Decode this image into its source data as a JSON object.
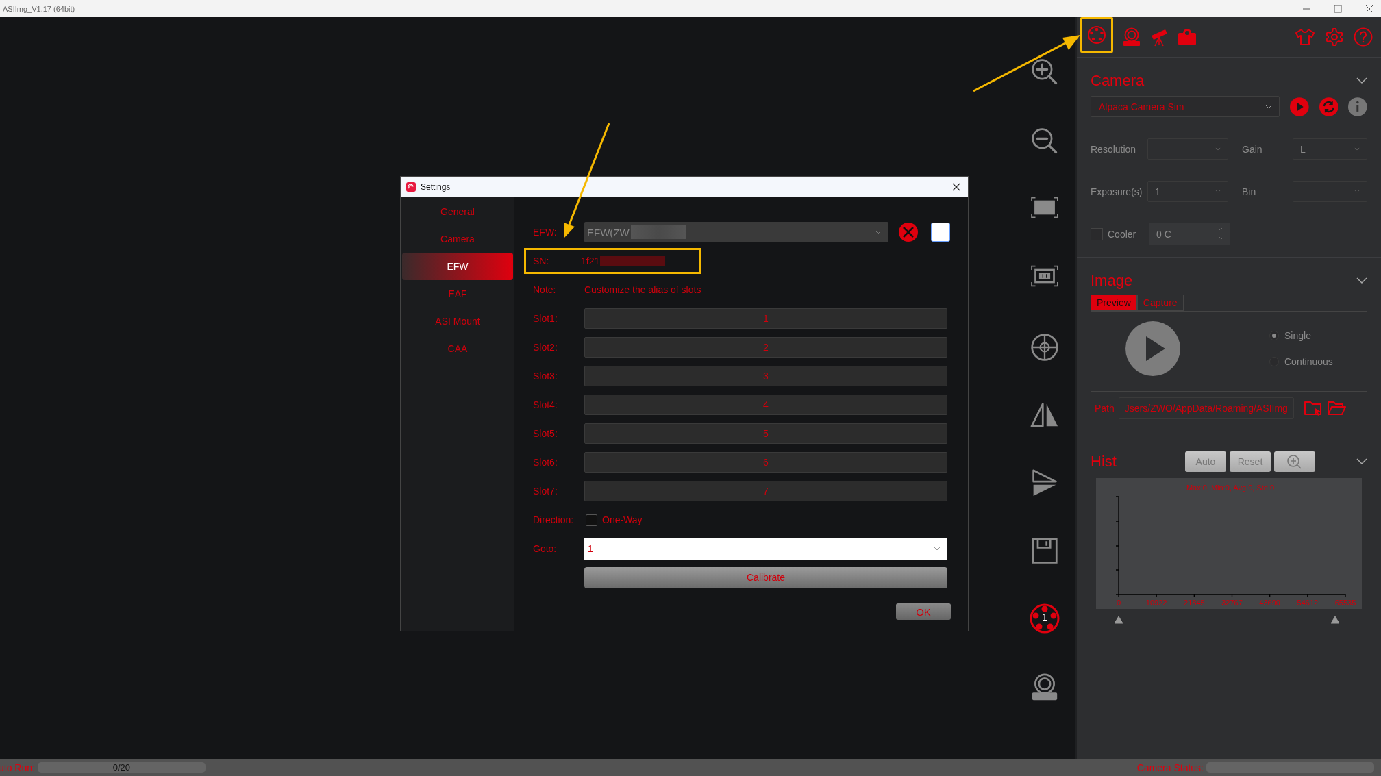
{
  "window": {
    "title": "ASIImg_V1.17 (64bit)"
  },
  "side_toolbar": {
    "filter_wheel_badge": "1"
  },
  "camera": {
    "title": "Camera",
    "device": "Alpaca Camera Sim",
    "fields": [
      {
        "label": "Resolution"
      },
      {
        "label": "Gain",
        "value": "L"
      },
      {
        "label": "Exposure(s)",
        "value": "1"
      },
      {
        "label": "Bin"
      }
    ],
    "cooler": {
      "label": "Cooler",
      "checked": false,
      "value": "0 C"
    }
  },
  "image": {
    "title": "Image",
    "tabs": [
      {
        "label": "Preview",
        "selected": true
      },
      {
        "label": "Capture",
        "selected": false
      }
    ],
    "modes": [
      {
        "label": "Single",
        "selected": true
      },
      {
        "label": "Continuous",
        "selected": false
      }
    ],
    "path_label": "Path",
    "path": "Jsers/ZWO/AppData/Roaming/ASIImg"
  },
  "hist": {
    "title": "Hist",
    "buttons": [
      "Auto",
      "Reset"
    ],
    "stats": "Max:0, Min:0, Avg:0, Std:0",
    "axis_labels": [
      "0",
      "10922",
      "21845",
      "32767",
      "43690",
      "54612",
      "65535"
    ]
  },
  "dialog": {
    "title": "Settings",
    "nav": [
      {
        "label": "General",
        "selected": false
      },
      {
        "label": "Camera",
        "selected": false
      },
      {
        "label": "EFW",
        "selected": true
      },
      {
        "label": "EAF",
        "selected": false
      },
      {
        "label": "ASI Mount",
        "selected": false
      },
      {
        "label": "CAA",
        "selected": false
      }
    ],
    "efw_label": "EFW:",
    "efw": "EFW(ZW",
    "sn_label": "SN:",
    "sn": "1f21",
    "note_label": "Note:",
    "note": "Customize the alias of slots",
    "slots": [
      {
        "label": "Slot1:",
        "value": "1"
      },
      {
        "label": "Slot2:",
        "value": "2"
      },
      {
        "label": "Slot3:",
        "value": "3"
      },
      {
        "label": "Slot4:",
        "value": "4"
      },
      {
        "label": "Slot5:",
        "value": "5"
      },
      {
        "label": "Slot6:",
        "value": "6"
      },
      {
        "label": "Slot7:",
        "value": "7"
      }
    ],
    "direction_label": "Direction:",
    "one_way": {
      "label": "One-Way",
      "checked": false
    },
    "goto_label": "Goto:",
    "goto": "1",
    "calibrate": "Calibrate",
    "ok": "OK"
  },
  "status_bar": {
    "auto_run_label": "uto Run:",
    "progress": "0/20",
    "level": 0,
    "camera_status_label": "Camera Status:"
  }
}
